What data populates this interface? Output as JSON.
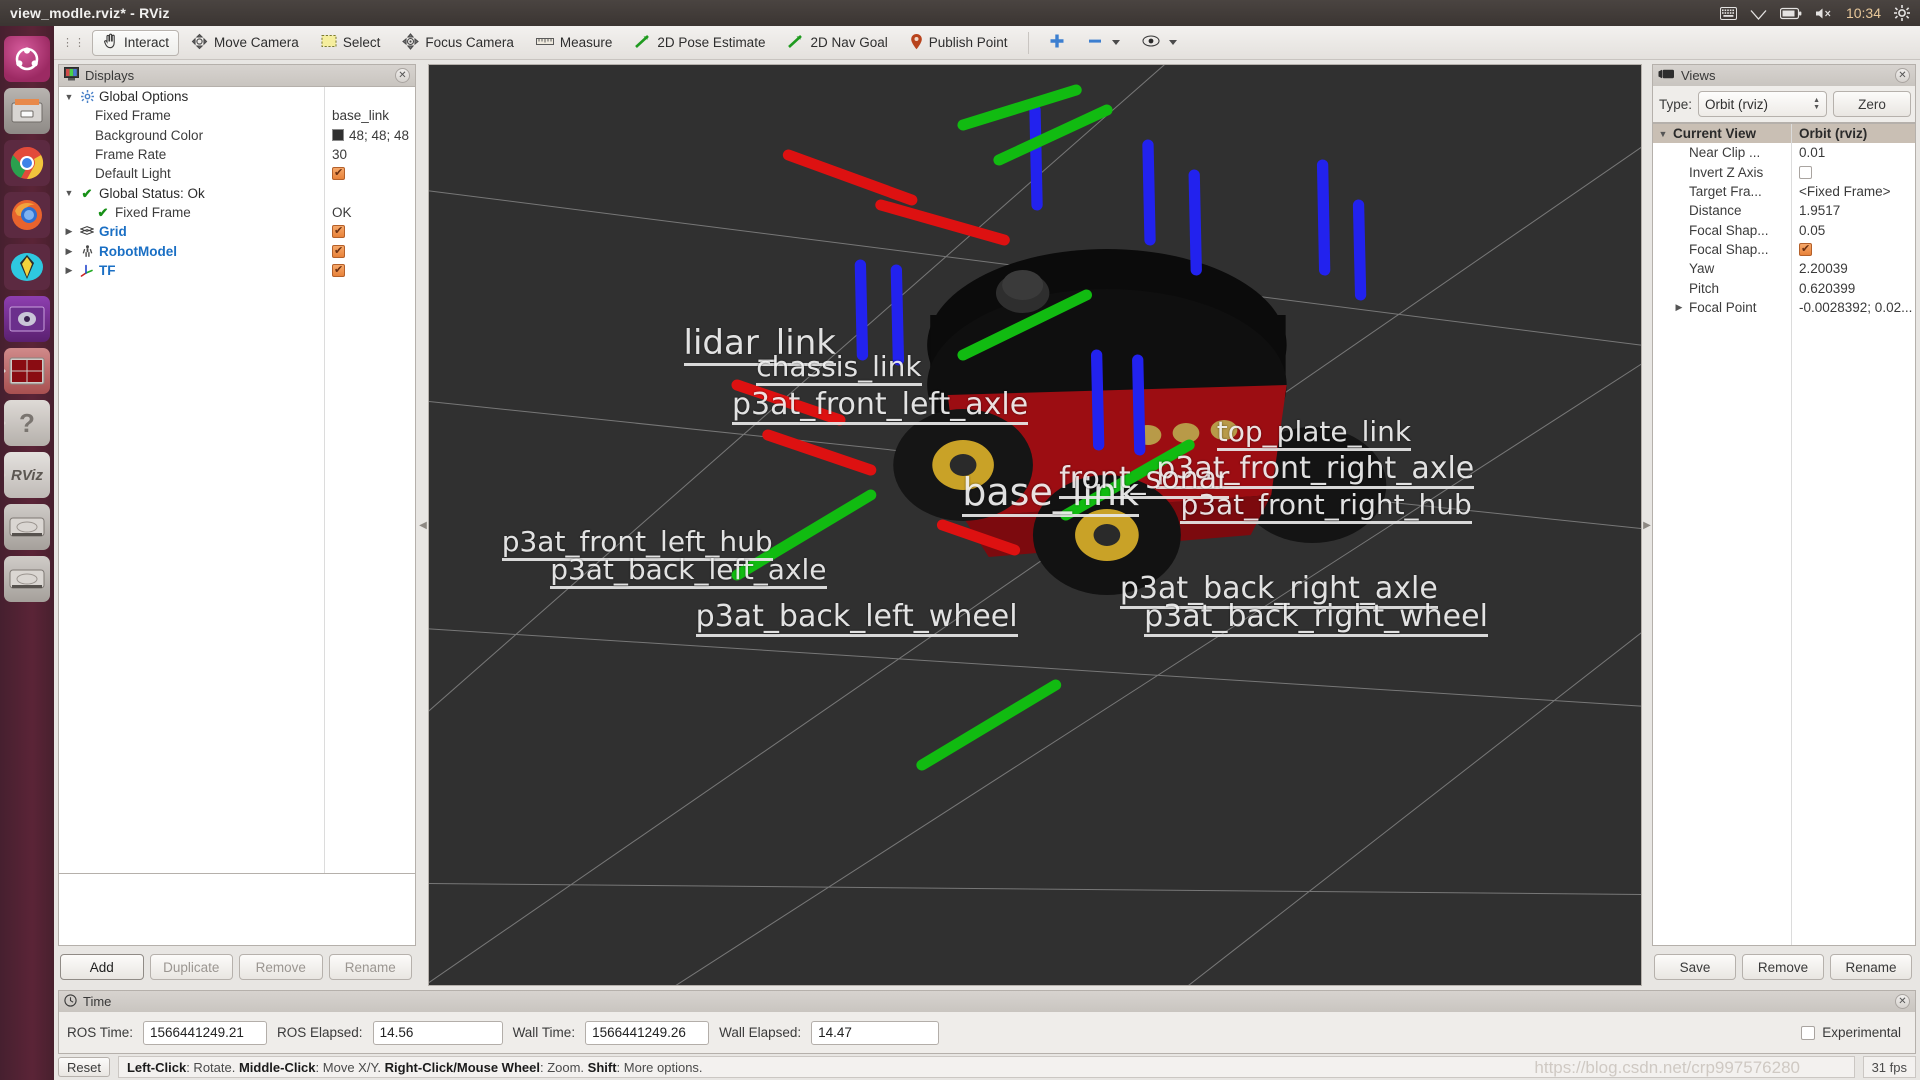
{
  "window": {
    "title": "view_modle.rviz* - RViz"
  },
  "system_tray": {
    "icons": [
      "keyboard-icon",
      "wifi-icon",
      "battery-icon",
      "volume-muted-icon"
    ],
    "clock": "10:34",
    "gear": "gear-icon"
  },
  "launcher": {
    "items": [
      {
        "name": "ubuntu-dash",
        "label": ""
      },
      {
        "name": "files",
        "label": ""
      },
      {
        "name": "chrome",
        "label": ""
      },
      {
        "name": "firefox",
        "label": ""
      },
      {
        "name": "thunderbird",
        "label": ""
      },
      {
        "name": "media-player",
        "label": ""
      },
      {
        "name": "terminal-red",
        "label": ""
      },
      {
        "name": "help",
        "label": "?"
      },
      {
        "name": "rviz",
        "label": "RViz"
      },
      {
        "name": "disk-1",
        "label": ""
      },
      {
        "name": "disk-2",
        "label": ""
      }
    ]
  },
  "toolbar": {
    "buttons": [
      {
        "icon": "hand-cursor-icon",
        "label": "Interact",
        "active": true
      },
      {
        "icon": "move-camera-icon",
        "label": "Move Camera",
        "active": false
      },
      {
        "icon": "select-icon",
        "label": "Select",
        "active": false
      },
      {
        "icon": "focus-camera-icon",
        "label": "Focus Camera",
        "active": false
      },
      {
        "icon": "ruler-icon",
        "label": "Measure",
        "active": false
      },
      {
        "icon": "pose-arrow-icon",
        "label": "2D Pose Estimate",
        "active": false
      },
      {
        "icon": "nav-goal-arrow-icon",
        "label": "2D Nav Goal",
        "active": false
      },
      {
        "icon": "map-pin-icon",
        "label": "Publish Point",
        "active": false
      }
    ],
    "plus_icon": "plus-icon",
    "minus_icon": "minus-icon",
    "eye_icon": "eye-icon"
  },
  "displays": {
    "title": "Displays",
    "panel_icon": "monitor-icon",
    "close_icon": "close-icon",
    "rows": [
      {
        "indent": 0,
        "arrow": "▼",
        "icon": "gear-blue-icon",
        "label": "Global Options",
        "style": "cat",
        "value": "",
        "value_type": "none"
      },
      {
        "indent": 1,
        "arrow": "",
        "icon": "",
        "label": "Fixed Frame",
        "style": "plain",
        "value": "base_link",
        "value_type": "text"
      },
      {
        "indent": 1,
        "arrow": "",
        "icon": "",
        "label": "Background Color",
        "style": "plain",
        "value": "48; 48; 48",
        "value_type": "color",
        "color": "#303030"
      },
      {
        "indent": 1,
        "arrow": "",
        "icon": "",
        "label": "Frame Rate",
        "style": "plain",
        "value": "30",
        "value_type": "text"
      },
      {
        "indent": 1,
        "arrow": "",
        "icon": "",
        "label": "Default Light",
        "style": "plain",
        "value": "",
        "value_type": "check-on"
      },
      {
        "indent": 0,
        "arrow": "▼",
        "icon": "check-green-icon",
        "label": "Global Status: Ok",
        "style": "cat",
        "value": "",
        "value_type": "none"
      },
      {
        "indent": 1,
        "arrow": "",
        "icon": "check-green-icon",
        "label": "Fixed Frame",
        "style": "plain",
        "value": "OK",
        "value_type": "text"
      },
      {
        "indent": 0,
        "arrow": "▶",
        "icon": "grid-icon",
        "label": "Grid",
        "style": "blue",
        "value": "",
        "value_type": "check-on"
      },
      {
        "indent": 0,
        "arrow": "▶",
        "icon": "robot-icon",
        "label": "RobotModel",
        "style": "blue",
        "value": "",
        "value_type": "check-on"
      },
      {
        "indent": 0,
        "arrow": "▶",
        "icon": "tf-axes-icon",
        "label": "TF",
        "style": "blue",
        "value": "",
        "value_type": "check-on"
      }
    ],
    "buttons": [
      {
        "label": "Add",
        "enabled": true
      },
      {
        "label": "Duplicate",
        "enabled": false
      },
      {
        "label": "Remove",
        "enabled": false
      },
      {
        "label": "Rename",
        "enabled": false
      }
    ]
  },
  "views": {
    "title": "Views",
    "panel_icon": "camera-icon",
    "close_icon": "close-icon",
    "type_label": "Type:",
    "type_value": "Orbit (rviz)",
    "zero_label": "Zero",
    "header": {
      "name": "Current View",
      "value": "Orbit (rviz)"
    },
    "rows": [
      {
        "indent": 1,
        "arrow": "",
        "label": "Near Clip ...",
        "value": "0.01",
        "value_type": "text"
      },
      {
        "indent": 1,
        "arrow": "",
        "label": "Invert Z Axis",
        "value": "",
        "value_type": "check-off"
      },
      {
        "indent": 1,
        "arrow": "",
        "label": "Target Fra...",
        "value": "<Fixed Frame>",
        "value_type": "text"
      },
      {
        "indent": 1,
        "arrow": "",
        "label": "Distance",
        "value": "1.9517",
        "value_type": "text"
      },
      {
        "indent": 1,
        "arrow": "",
        "label": "Focal Shap...",
        "value": "0.05",
        "value_type": "text"
      },
      {
        "indent": 1,
        "arrow": "",
        "label": "Focal Shap...",
        "value": "",
        "value_type": "check-on"
      },
      {
        "indent": 1,
        "arrow": "",
        "label": "Yaw",
        "value": "2.20039",
        "value_type": "text"
      },
      {
        "indent": 1,
        "arrow": "",
        "label": "Pitch",
        "value": "0.620399",
        "value_type": "text"
      },
      {
        "indent": 1,
        "arrow": "▶",
        "label": "Focal Point",
        "value": "-0.0028392; 0.02...",
        "value_type": "text"
      }
    ],
    "buttons": [
      {
        "label": "Save",
        "enabled": true
      },
      {
        "label": "Remove",
        "enabled": true
      },
      {
        "label": "Rename",
        "enabled": true
      }
    ]
  },
  "time_panel": {
    "title": "Time",
    "icon": "clock-icon",
    "close_icon": "close-icon",
    "fields": [
      {
        "label": "ROS Time:",
        "value": "1566441249.21",
        "name": "ros-time"
      },
      {
        "label": "ROS Elapsed:",
        "value": "14.56",
        "name": "ros-elapsed"
      },
      {
        "label": "Wall Time:",
        "value": "1566441249.26",
        "name": "wall-time"
      },
      {
        "label": "Wall Elapsed:",
        "value": "14.47",
        "name": "wall-elapsed"
      }
    ],
    "experimental_label": "Experimental",
    "experimental_checked": false
  },
  "status_bar": {
    "reset_label": "Reset",
    "hint_parts": [
      {
        "bold": "Left-Click",
        "text": ": Rotate.  "
      },
      {
        "bold": "Middle-Click",
        "text": ": Move X/Y.  "
      },
      {
        "bold": "Right-Click/Mouse Wheel",
        "text": ": Zoom.  "
      },
      {
        "bold": "Shift",
        "text": ": More options."
      }
    ],
    "hint_full": "Left-Click: Rotate.  Middle-Click: Move X/Y.  Right-Click/Mouse Wheel: Zoom.  Shift: More options.",
    "fps": "31 fps",
    "watermark": "https://blog.csdn.net/crp997576280"
  },
  "viewport": {
    "background_color": "#303030",
    "grid_color": "#9a9a9a",
    "tf_labels": [
      "lidar_link",
      "p3at_front_left_axle",
      "base_link",
      "p3at_front_right_axle",
      "p3at_front_left_hub",
      "p3at_front_right_hub",
      "p3at_back_left_axle",
      "p3at_back_right_axle",
      "p3at_back_left_wheel",
      "p3at_back_right_wheel",
      "front_sonar",
      "top_plate_link",
      "chassis_link"
    ],
    "axis_colors": {
      "x": "#e01010",
      "y": "#10c010",
      "z": "#2020e8"
    },
    "robot_colors": {
      "body": "#9c0d12",
      "chassis": "#111111",
      "tire": "#181818",
      "hub": "#c9a227"
    }
  }
}
